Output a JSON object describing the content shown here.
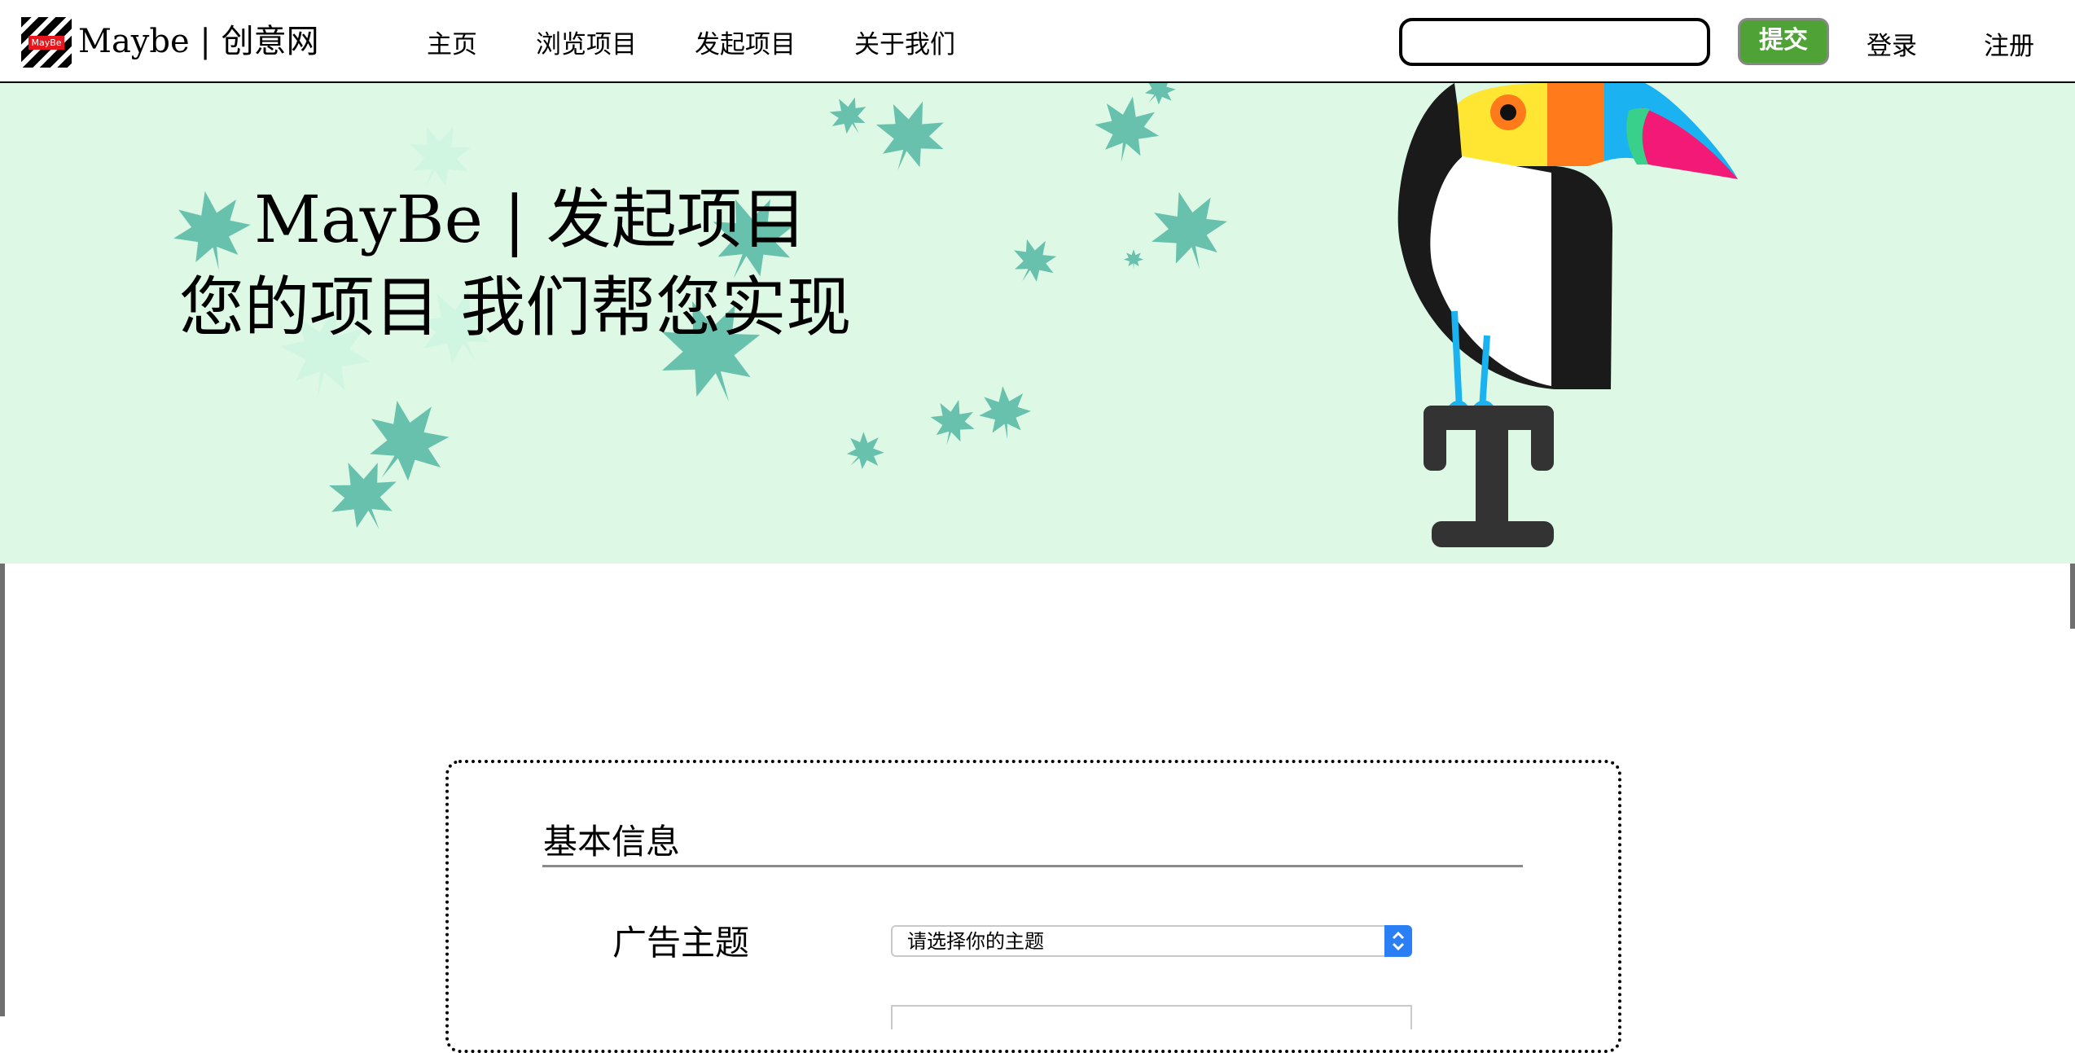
{
  "header": {
    "logo_text": "MayBe",
    "brand": "Maybe | 创意网",
    "nav": {
      "home": "主页",
      "browse": "浏览项目",
      "launch": "发起项目",
      "about": "关于我们"
    },
    "search": {
      "value": "",
      "placeholder": ""
    },
    "submit_label": "提交",
    "login_label": "登录",
    "register_label": "注册"
  },
  "banner": {
    "title": "MayBe | 发起项目",
    "subtitle": "您的项目 我们帮您实现"
  },
  "form": {
    "section_title": "基本信息",
    "topic_label": "广告主题",
    "topic_select": "请选择你的主题"
  },
  "colors": {
    "banner_bg": "#ddf9e5",
    "submit_green": "#4fa336",
    "select_accent": "#2a7ff5"
  }
}
